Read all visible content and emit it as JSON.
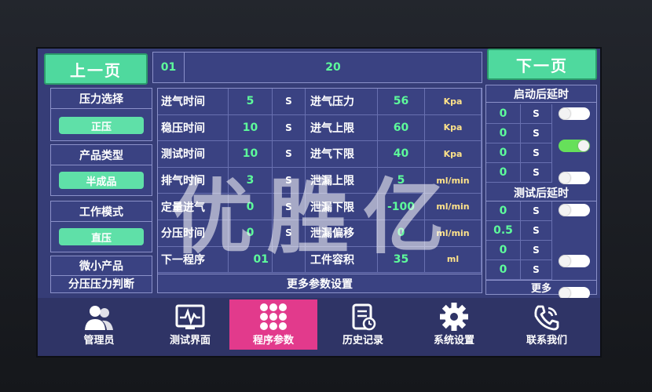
{
  "nav_top": {
    "prev_label": "上一页",
    "next_label": "下一页",
    "page_start": "01",
    "page_end": "20"
  },
  "left": {
    "pressure_select": {
      "title": "压力选择",
      "value": "正压"
    },
    "product_type": {
      "title": "产品类型",
      "value": "半成品"
    },
    "work_mode": {
      "title": "工作模式",
      "value": "直压"
    },
    "micro": {
      "line1": "微小产品",
      "line2": "分压压力判断"
    }
  },
  "params": {
    "left_rows": [
      {
        "label": "进气时间",
        "value": "5",
        "unit": "S"
      },
      {
        "label": "稳压时间",
        "value": "10",
        "unit": "S"
      },
      {
        "label": "测试时间",
        "value": "10",
        "unit": "S"
      },
      {
        "label": "排气时间",
        "value": "3",
        "unit": "S"
      },
      {
        "label": "定量进气",
        "value": "0",
        "unit": "S"
      },
      {
        "label": "分压时间",
        "value": "0",
        "unit": "S"
      },
      {
        "label": "下一程序",
        "value": "01",
        "unit": ""
      }
    ],
    "right_rows": [
      {
        "label": "进气压力",
        "value": "56",
        "unit": "Kpa"
      },
      {
        "label": "进气上限",
        "value": "60",
        "unit": "Kpa"
      },
      {
        "label": "进气下限",
        "value": "40",
        "unit": "Kpa"
      },
      {
        "label": "泄漏上限",
        "value": "5",
        "unit": "ml/min"
      },
      {
        "label": "泄漏下限",
        "value": "-100",
        "unit": "ml/min"
      },
      {
        "label": "泄漏偏移",
        "value": "0",
        "unit": "ml/min"
      },
      {
        "label": "工件容积",
        "value": "35",
        "unit": "ml"
      }
    ],
    "more_label": "更多参数设置"
  },
  "delays": {
    "start_title": "启动后延时",
    "start_rows": [
      {
        "value": "0",
        "unit": "S",
        "on": false
      },
      {
        "value": "0",
        "unit": "S",
        "on": true
      },
      {
        "value": "0",
        "unit": "S",
        "on": false
      },
      {
        "value": "0",
        "unit": "S",
        "on": false
      }
    ],
    "test_title": "测试后延时",
    "test_rows": [
      {
        "value": "0",
        "unit": "S",
        "on": false
      },
      {
        "value": "0.5",
        "unit": "S",
        "on": false
      },
      {
        "value": "0",
        "unit": "S",
        "on": false
      },
      {
        "value": "0",
        "unit": "S",
        "on": false
      }
    ],
    "more_label": "更多"
  },
  "bottom_nav": [
    {
      "label": "管理员",
      "icon": "users-icon"
    },
    {
      "label": "测试界面",
      "icon": "monitor-wave-icon"
    },
    {
      "label": "程序参数",
      "icon": "grid-dots-icon",
      "active": true
    },
    {
      "label": "历史记录",
      "icon": "history-doc-icon"
    },
    {
      "label": "系统设置",
      "icon": "gear-icon"
    },
    {
      "label": "联系我们",
      "icon": "phone-icon"
    }
  ],
  "watermark": "优胜亿"
}
